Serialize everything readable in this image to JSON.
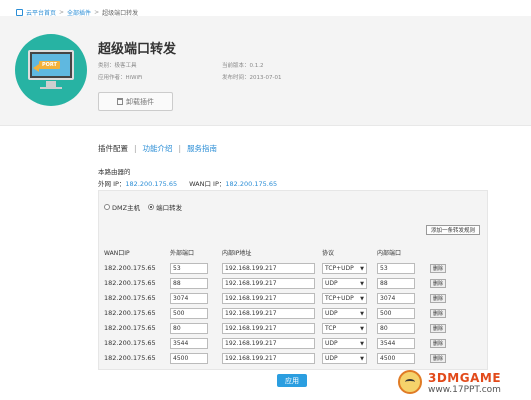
{
  "breadcrumb": {
    "home": "云平台首页",
    "all_plugins": "全部插件",
    "current": "超级端口转发",
    "separator": ">"
  },
  "plugin": {
    "title": "超级端口转发",
    "logo_tag": "PORT",
    "category": "类别：极客工具",
    "author": "应用作者：HiWiFi",
    "version": "当前版本：0.1.2",
    "release_date": "发布时间：2013-07-01",
    "uninstall_label": "卸载插件"
  },
  "tabs": [
    {
      "label": "插件配置",
      "active": true
    },
    {
      "label": "功能介绍",
      "active": false
    },
    {
      "label": "服务指南",
      "active": false
    }
  ],
  "router": {
    "title": "本路由器的",
    "external_ip_label": "外网 IP：",
    "external_ip": "182.200.175.65",
    "wan_ip_label": "WAN口 IP：",
    "wan_ip": "182.200.175.65"
  },
  "mode": {
    "dmz_label": "DMZ主机",
    "port_label": "端口转发",
    "selected": "port"
  },
  "add_rule_label": "添加一条转发规则",
  "columns": {
    "wan_ip": "WAN口IP",
    "ext_port": "外部端口",
    "int_ip": "内部IP地址",
    "protocol": "协议",
    "int_port": "内部端口"
  },
  "rules": [
    {
      "wan_ip": "182.200.175.65",
      "ext_port": "53",
      "int_ip": "192.168.199.217",
      "protocol": "TCP+UDP",
      "int_port": "53",
      "delete": "删除"
    },
    {
      "wan_ip": "182.200.175.65",
      "ext_port": "88",
      "int_ip": "192.168.199.217",
      "protocol": "UDP",
      "int_port": "88",
      "delete": "删除"
    },
    {
      "wan_ip": "182.200.175.65",
      "ext_port": "3074",
      "int_ip": "192.168.199.217",
      "protocol": "TCP+UDP",
      "int_port": "3074",
      "delete": "删除"
    },
    {
      "wan_ip": "182.200.175.65",
      "ext_port": "500",
      "int_ip": "192.168.199.217",
      "protocol": "UDP",
      "int_port": "500",
      "delete": "删除"
    },
    {
      "wan_ip": "182.200.175.65",
      "ext_port": "80",
      "int_ip": "192.168.199.217",
      "protocol": "TCP",
      "int_port": "80",
      "delete": "删除"
    },
    {
      "wan_ip": "182.200.175.65",
      "ext_port": "3544",
      "int_ip": "192.168.199.217",
      "protocol": "UDP",
      "int_port": "3544",
      "delete": "删除"
    },
    {
      "wan_ip": "182.200.175.65",
      "ext_port": "4500",
      "int_ip": "192.168.199.217",
      "protocol": "UDP",
      "int_port": "4500",
      "delete": "删除"
    }
  ],
  "apply_label": "应用",
  "watermark": {
    "brand": "3DMGAME",
    "sub": "www.17PPT.com"
  },
  "colors": {
    "link": "#2b8ed6",
    "accent": "#2b9ee0",
    "logo_bg": "#27b3a3"
  }
}
